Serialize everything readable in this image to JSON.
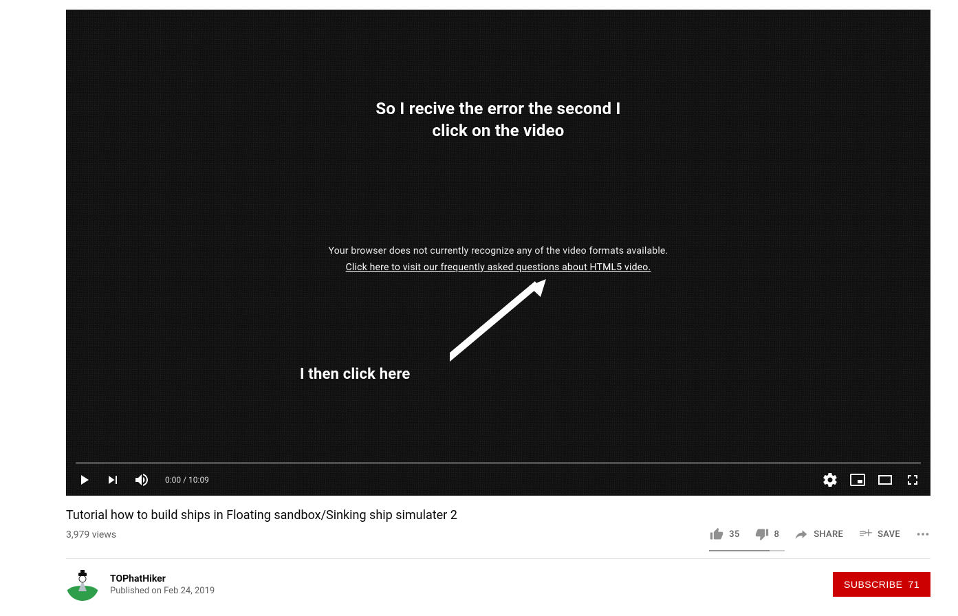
{
  "annotations": {
    "top": "So I recive the error the second I\nclick on the video",
    "bottom": "I then click here"
  },
  "player": {
    "error_message": "Your browser does not currently recognize any of the video formats available.",
    "error_link_text": "Click here to visit our frequently asked questions about HTML5 video.",
    "current_time": "0:00",
    "duration": "10:09",
    "time_separator": " / "
  },
  "video": {
    "title": "Tutorial how to build ships in Floating sandbox/Sinking ship simulater 2",
    "views": "3,979 views"
  },
  "actions": {
    "likes": "35",
    "dislikes": "8",
    "share_label": "SHARE",
    "save_label": "SAVE"
  },
  "channel": {
    "name": "TOPhatHiker",
    "published": "Published on Feb 24, 2019"
  },
  "subscribe": {
    "label": "SUBSCRIBE",
    "count": "71"
  }
}
